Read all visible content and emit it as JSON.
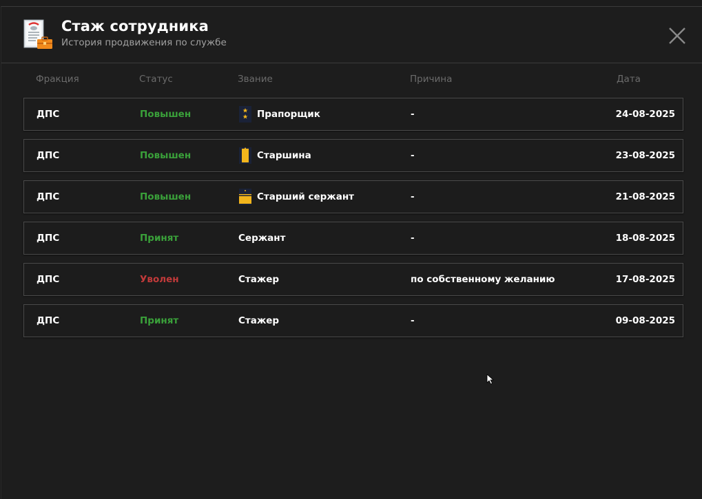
{
  "header": {
    "title": "Стаж сотрудника",
    "subtitle": "История продвижения по службе",
    "app_icon": "document-briefcase-icon",
    "close_icon": "close-icon"
  },
  "columns": {
    "faction": "Фракция",
    "status": "Статус",
    "rank": "Звание",
    "reason": "Причина",
    "date": "Дата"
  },
  "colors": {
    "promoted": "#3aa13a",
    "hired": "#3aa13a",
    "fired": "#c23a3a",
    "rank_gold": "#f2b51c",
    "rank_navy": "#1a2238"
  },
  "rows": [
    {
      "faction": "ДПС",
      "status": "Повышен",
      "status_kind": "up",
      "rank": "Прапорщик",
      "rank_icon": "praporshchik-insignia-icon",
      "reason": "-",
      "date": "24-08-2025"
    },
    {
      "faction": "ДПС",
      "status": "Повышен",
      "status_kind": "up",
      "rank": "Старшина",
      "rank_icon": "starshina-insignia-icon",
      "reason": "-",
      "date": "23-08-2025"
    },
    {
      "faction": "ДПС",
      "status": "Повышен",
      "status_kind": "up",
      "rank": "Старший сержант",
      "rank_icon": "senior-sergeant-insignia-icon",
      "reason": "-",
      "date": "21-08-2025"
    },
    {
      "faction": "ДПС",
      "status": "Принят",
      "status_kind": "in",
      "rank": "Сержант",
      "rank_icon": "",
      "reason": "-",
      "date": "18-08-2025"
    },
    {
      "faction": "ДПС",
      "status": "Уволен",
      "status_kind": "out",
      "rank": "Стажер",
      "rank_icon": "",
      "reason": "по собственному желанию",
      "date": "17-08-2025"
    },
    {
      "faction": "ДПС",
      "status": "Принят",
      "status_kind": "in",
      "rank": "Стажер",
      "rank_icon": "",
      "reason": "-",
      "date": "09-08-2025"
    }
  ]
}
